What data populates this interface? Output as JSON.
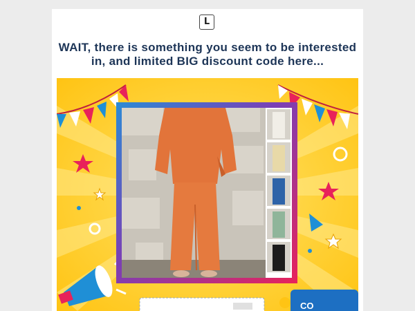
{
  "logo": {
    "letter": "L"
  },
  "headline": "WAIT, there is something you seem to be interested in, and limited BIG discount code here...",
  "banner": {
    "coupon_label": "CO",
    "colors": {
      "background": "#ffd21f",
      "frame_start": "#2a8bd6",
      "frame_end": "#e8225a",
      "outfit_main": "#e2743a",
      "coupon": "#1d6fc2"
    },
    "thumbnails": [
      {
        "name": "white-outfit",
        "color": "#f1eee7"
      },
      {
        "name": "beige-outfit",
        "color": "#e8d9a8"
      },
      {
        "name": "blue-outfit",
        "color": "#2e63a8"
      },
      {
        "name": "green-outfit",
        "color": "#8fb59a"
      },
      {
        "name": "black-outfit",
        "color": "#1c1c1c"
      }
    ]
  }
}
